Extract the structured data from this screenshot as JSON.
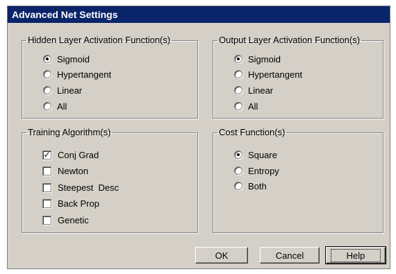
{
  "dialog": {
    "title": "Advanced Net Settings"
  },
  "hidden_layer": {
    "legend": "Hidden Layer Activation Function(s)",
    "options": [
      {
        "label": "Sigmoid",
        "selected": true
      },
      {
        "label": "Hypertangent",
        "selected": false
      },
      {
        "label": "Linear",
        "selected": false
      },
      {
        "label": "All",
        "selected": false
      }
    ]
  },
  "output_layer": {
    "legend": "Output Layer Activation Function(s)",
    "options": [
      {
        "label": "Sigmoid",
        "selected": true
      },
      {
        "label": "Hypertangent",
        "selected": false
      },
      {
        "label": "Linear",
        "selected": false
      },
      {
        "label": "All",
        "selected": false
      }
    ]
  },
  "training": {
    "legend": "Training Algorithm(s)",
    "options": [
      {
        "label": "Conj Grad",
        "checked": true
      },
      {
        "label": "Newton",
        "checked": false
      },
      {
        "label": "Steepest  Desc",
        "checked": false
      },
      {
        "label": "Back Prop",
        "checked": false
      },
      {
        "label": "Genetic",
        "checked": false
      }
    ]
  },
  "cost": {
    "legend": "Cost Function(s)",
    "options": [
      {
        "label": "Square",
        "selected": true
      },
      {
        "label": "Entropy",
        "selected": false
      },
      {
        "label": "Both",
        "selected": false
      }
    ]
  },
  "buttons": {
    "ok": "OK",
    "cancel": "Cancel",
    "help": "Help"
  },
  "colors": {
    "title_bar": "#0a246a",
    "dialog_face": "#d4d0c8"
  }
}
